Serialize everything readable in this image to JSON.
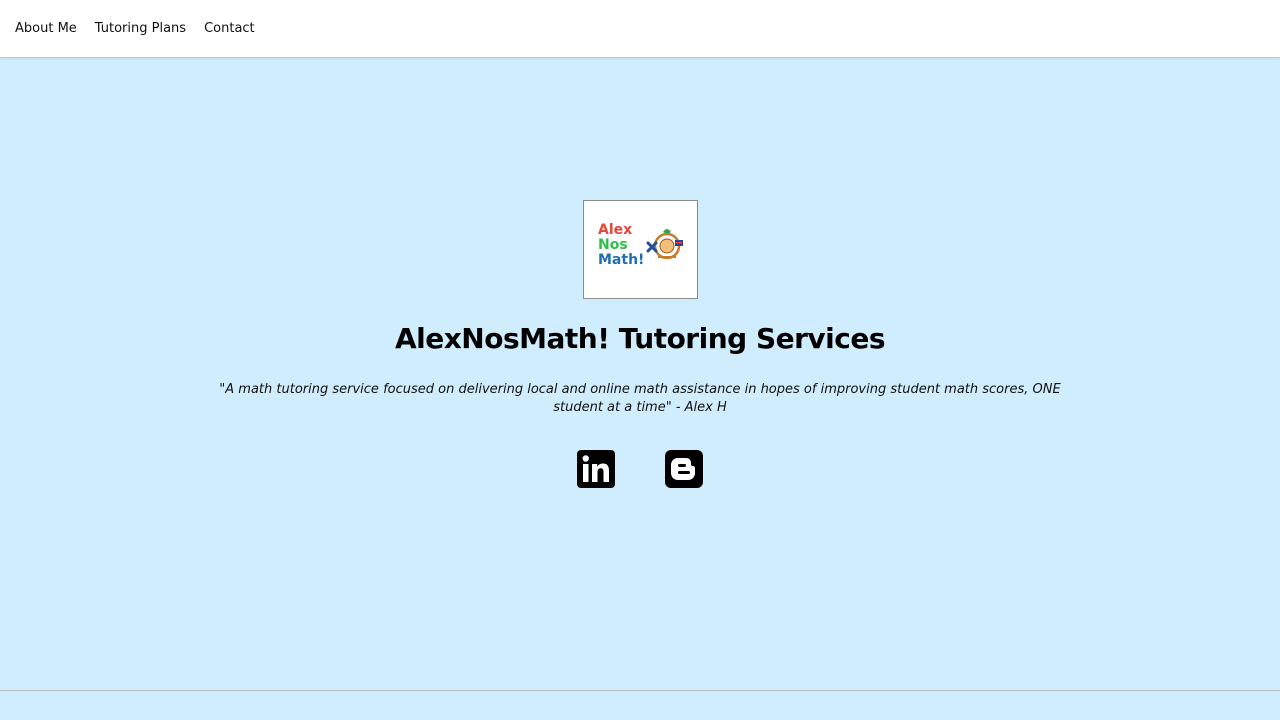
{
  "nav": {
    "items": [
      {
        "label": "About Me"
      },
      {
        "label": "Tutoring Plans"
      },
      {
        "label": "Contact"
      }
    ]
  },
  "logo": {
    "line1": "Alex",
    "line2": "Nos",
    "line3": "Math!",
    "colors": {
      "line1": "#e6453a",
      "line2": "#2fbf4a",
      "line3": "#1f6fb3"
    }
  },
  "hero": {
    "title": "AlexNosMath! Tutoring Services",
    "tagline": "\"A math tutoring service focused on delivering local and online math assistance in hopes of improving student math scores, ONE student at a time\" - Alex H"
  },
  "social": [
    {
      "icon": "linkedin-icon"
    },
    {
      "icon": "blogger-icon"
    }
  ],
  "colors": {
    "background": "#cfedfc",
    "navbar": "#ffffff",
    "text": "#000000"
  }
}
